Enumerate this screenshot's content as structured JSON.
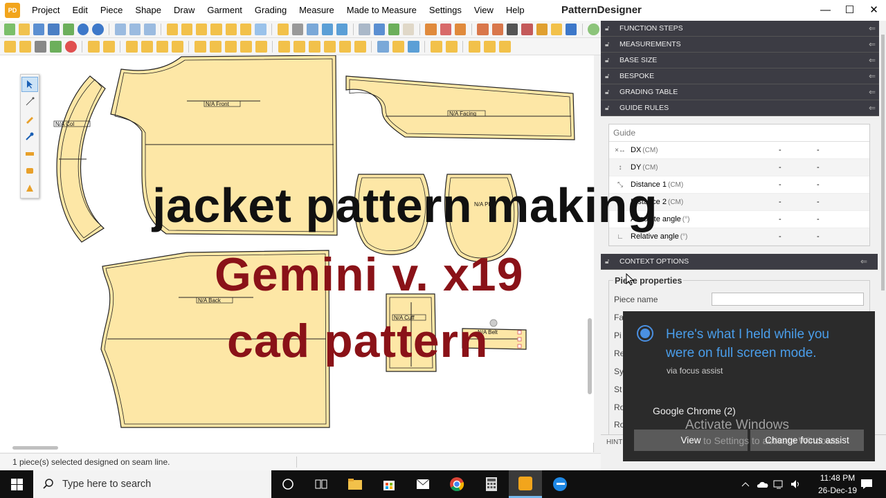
{
  "app": {
    "title": "PatternDesigner",
    "logo_text": "PD",
    "menu": [
      "Project",
      "Edit",
      "Piece",
      "Shape",
      "Draw",
      "Garment",
      "Grading",
      "Measure",
      "Made to Measure",
      "Settings",
      "View",
      "Help"
    ],
    "window_controls": [
      "—",
      "☐",
      "✕"
    ]
  },
  "canvas": {
    "pieces": [
      {
        "label": "N/A Front"
      },
      {
        "label": "N/A Facing"
      },
      {
        "label": "N/A Back"
      },
      {
        "label": "N/A Cuff"
      },
      {
        "label": "N/A Col"
      },
      {
        "label": "N/A Belt"
      },
      {
        "label": "N/A Pkt"
      }
    ]
  },
  "status": {
    "message": "1 piece(s) selected designed on seam line."
  },
  "panel": {
    "sections": [
      "FUNCTION STEPS",
      "MEASUREMENTS",
      "BASE SIZE",
      "BESPOKE",
      "GRADING TABLE",
      "GUIDE RULES"
    ],
    "guide": {
      "header": "Guide",
      "rows": [
        {
          "label": "DX",
          "unit": "(CM)",
          "v1": "-",
          "v2": "-",
          "icon": "dx-icon"
        },
        {
          "label": "DY",
          "unit": "(CM)",
          "v1": "-",
          "v2": "-",
          "icon": "dy-icon"
        },
        {
          "label": "Distance 1",
          "unit": "(CM)",
          "v1": "-",
          "v2": "-",
          "icon": "distance-icon"
        },
        {
          "label": "Distance 2",
          "unit": "(CM)",
          "v1": "-",
          "v2": "-",
          "icon": "distance-icon"
        },
        {
          "label": "Absolute angle",
          "unit": "(°)",
          "v1": "-",
          "v2": "-",
          "icon": "angle-icon"
        },
        {
          "label": "Relative angle",
          "unit": "(°)",
          "v1": "-",
          "v2": "-",
          "icon": "angle-icon"
        }
      ]
    },
    "context": {
      "header": "CONTEXT OPTIONS",
      "title": "Piece properties",
      "fields": [
        "Piece name",
        "Fa",
        "Pi",
        "Re",
        "Sy",
        "St",
        "Ro",
        "Ro"
      ],
      "piece_name_value": ""
    },
    "hints": "HINTS"
  },
  "overlay": {
    "line1": "jacket pattern making",
    "line2": "Gemini v. x19",
    "line3": "cad pattern"
  },
  "toast": {
    "heading": "Here's what I held while you were on full screen mode.",
    "sub": "via focus assist",
    "app": "Google Chrome (2)",
    "btn_view": "View",
    "btn_change": "Change focus assist"
  },
  "watermark": {
    "line1": "Activate Windows",
    "line2": "to Settings to activate Windows."
  },
  "taskbar": {
    "search_placeholder": "Type here to search",
    "time": "11:48 PM",
    "date": "26-Dec-19"
  },
  "colors": {
    "piece_fill": "#fde7a6",
    "panel_header": "#3c3c44",
    "accent": "#4a90e2",
    "overlay_red": "#8a1218"
  }
}
